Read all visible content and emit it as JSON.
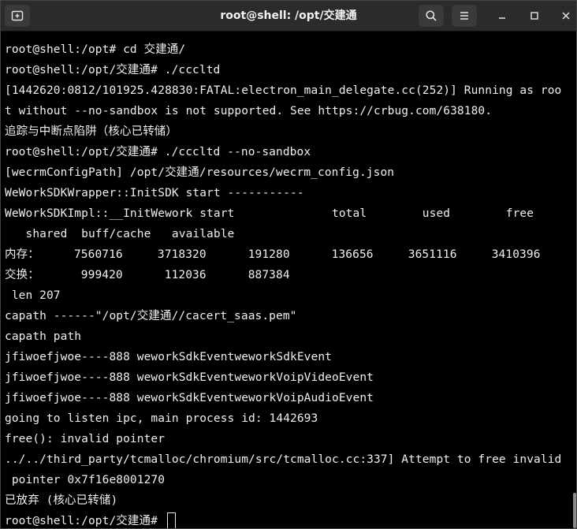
{
  "window": {
    "title": "root@shell: /opt/交建通"
  },
  "icons": {
    "new_tab": "new-tab-icon",
    "search": "search-icon",
    "menu": "hamburger-menu-icon",
    "minimize": "minimize-icon",
    "maximize": "maximize-icon",
    "close": "close-icon"
  },
  "terminal": {
    "lines": [
      "root@shell:/opt# cd 交建通/",
      "root@shell:/opt/交建通# ./cccltd",
      "[1442620:0812/101925.428830:FATAL:electron_main_delegate.cc(252)] Running as roo",
      "t without --no-sandbox is not supported. See https://crbug.com/638180.",
      "追踪与中断点陷阱（核心已转储）",
      "root@shell:/opt/交建通# ./cccltd --no-sandbox",
      "[wecrmConfigPath] /opt/交建通/resources/wecrm_config.json",
      "WeWorkSDKWrapper::InitSDK start -----------",
      "WeWorkSDKImpl::__InitWework start              total        used        free",
      "   shared  buff/cache   available",
      "内存：     7560716     3718320      191280      136656     3651116     3410396",
      "交换：      999420      112036      887384",
      " len 207",
      "capath ------\"/opt/交建通//cacert_saas.pem\"",
      "capath path",
      "jfiwoefjwoe----888 weworkSdkEventweworkSdkEvent",
      "jfiwoefjwoe----888 weworkSdkEventweworkVoipVideoEvent",
      "jfiwoefjwoe----888 weworkSdkEventweworkVoipAudioEvent",
      "going to listen ipc, main process id: 1442693",
      "free(): invalid pointer",
      "../../third_party/tcmalloc/chromium/src/tcmalloc.cc:337] Attempt to free invalid",
      " pointer 0x7f16e8001270",
      "已放弃 (核心已转储)"
    ],
    "prompt": "root@shell:/opt/交建通# "
  }
}
